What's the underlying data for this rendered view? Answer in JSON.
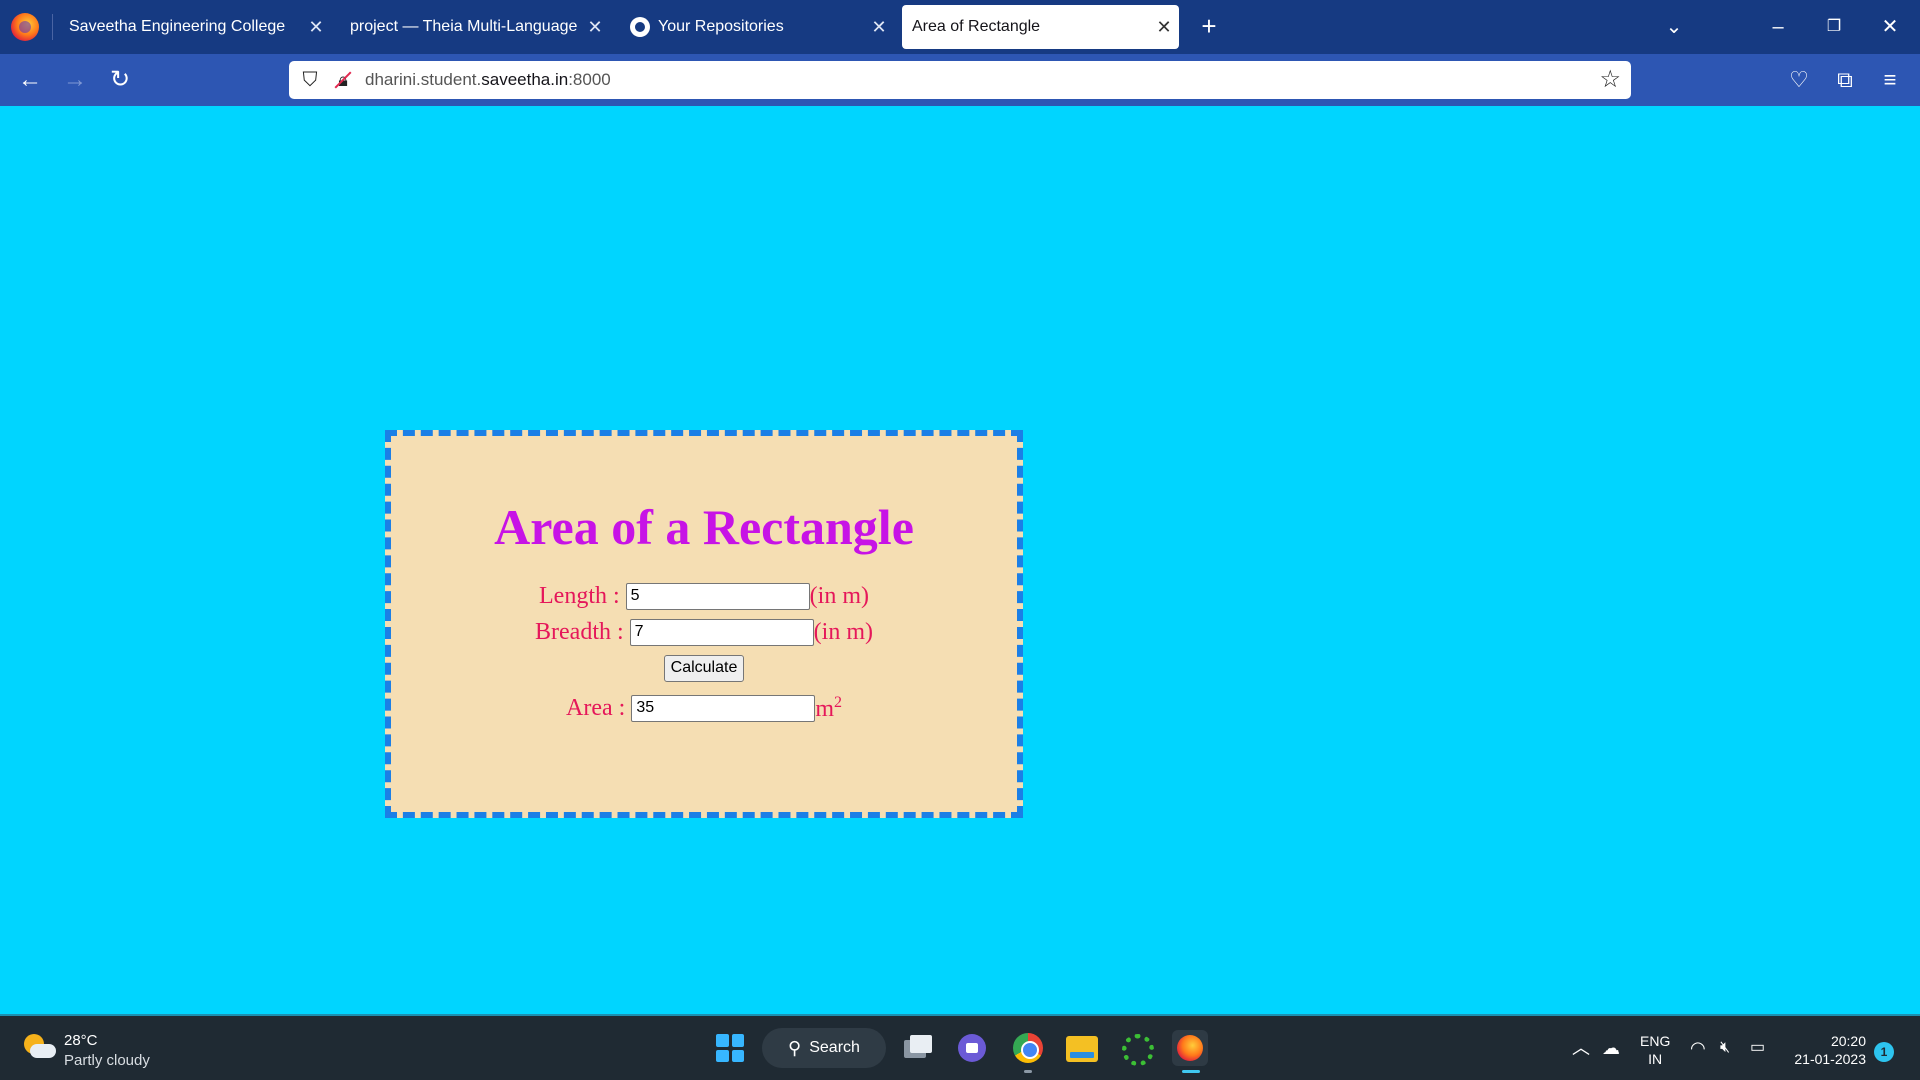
{
  "browser": {
    "tabs": [
      {
        "title": "Saveetha Engineering College"
      },
      {
        "title": "project — Theia Multi-Language Ex"
      },
      {
        "title": "Your Repositories"
      },
      {
        "title": "Area of Rectangle"
      }
    ],
    "address": {
      "prefix": "dharini.student.",
      "host": "saveetha.in",
      "suffix": ":8000"
    }
  },
  "page": {
    "heading": "Area of a Rectangle",
    "length_label": "Length :",
    "length_value": "5",
    "length_unit": "(in m)",
    "breadth_label": "Breadth :",
    "breadth_value": "7",
    "breadth_unit": "(in m)",
    "calculate_label": "Calculate",
    "area_label": "Area :",
    "area_value": "35",
    "area_unit": "m",
    "area_unit_exp": "2"
  },
  "taskbar": {
    "weather_temp": "28°C",
    "weather_desc": "Partly cloudy",
    "search_label": "Search",
    "lang_line1": "ENG",
    "lang_line2": "IN",
    "time": "20:20",
    "date": "21-01-2023",
    "notifications": "1"
  },
  "colors": {
    "page_bg": "#00d5ff",
    "card_bg": "#f5deb3",
    "card_border": "#1b7fe6",
    "heading": "#c713e6",
    "labels": "#e5175a",
    "tabbar": "#163a82",
    "navbar": "#2d56b3"
  }
}
